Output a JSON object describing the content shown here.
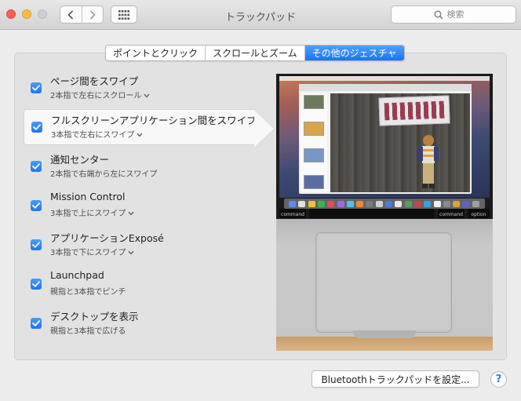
{
  "window": {
    "title": "トラックパッド",
    "search_placeholder": "検索"
  },
  "tabs": [
    {
      "label": "ポイントとクリック",
      "active": false
    },
    {
      "label": "スクロールとズーム",
      "active": false
    },
    {
      "label": "その他のジェスチャ",
      "active": true
    }
  ],
  "gestures": [
    {
      "title": "ページ間をスワイプ",
      "subtitle": "2本指で左右にスクロール",
      "has_menu": true,
      "checked": true,
      "selected": false
    },
    {
      "title": "フルスクリーンアプリケーション間をスワイプ",
      "subtitle": "3本指で左右にスワイプ",
      "has_menu": true,
      "checked": true,
      "selected": true
    },
    {
      "title": "通知センター",
      "subtitle": "2本指で右端から左にスワイプ",
      "has_menu": false,
      "checked": true,
      "selected": false
    },
    {
      "title": "Mission Control",
      "subtitle": "3本指で上にスワイプ",
      "has_menu": true,
      "checked": true,
      "selected": false
    },
    {
      "title": "アプリケーションExposé",
      "subtitle": "3本指で下にスワイプ",
      "has_menu": true,
      "checked": true,
      "selected": false
    },
    {
      "title": "Launchpad",
      "subtitle": "親指と3本指でピンチ",
      "has_menu": false,
      "checked": true,
      "selected": false
    },
    {
      "title": "デスクトップを表示",
      "subtitle": "親指と3本指で広げる",
      "has_menu": false,
      "checked": true,
      "selected": false
    }
  ],
  "preview": {
    "keys": {
      "command_left": "command",
      "command_right": "command",
      "option_right": "option"
    }
  },
  "buttons": {
    "bluetooth": "Bluetoothトラックパッドを設定...",
    "help": "?"
  },
  "colors": {
    "accent": "#1a74f2",
    "checkbox": "#2a7df5"
  }
}
